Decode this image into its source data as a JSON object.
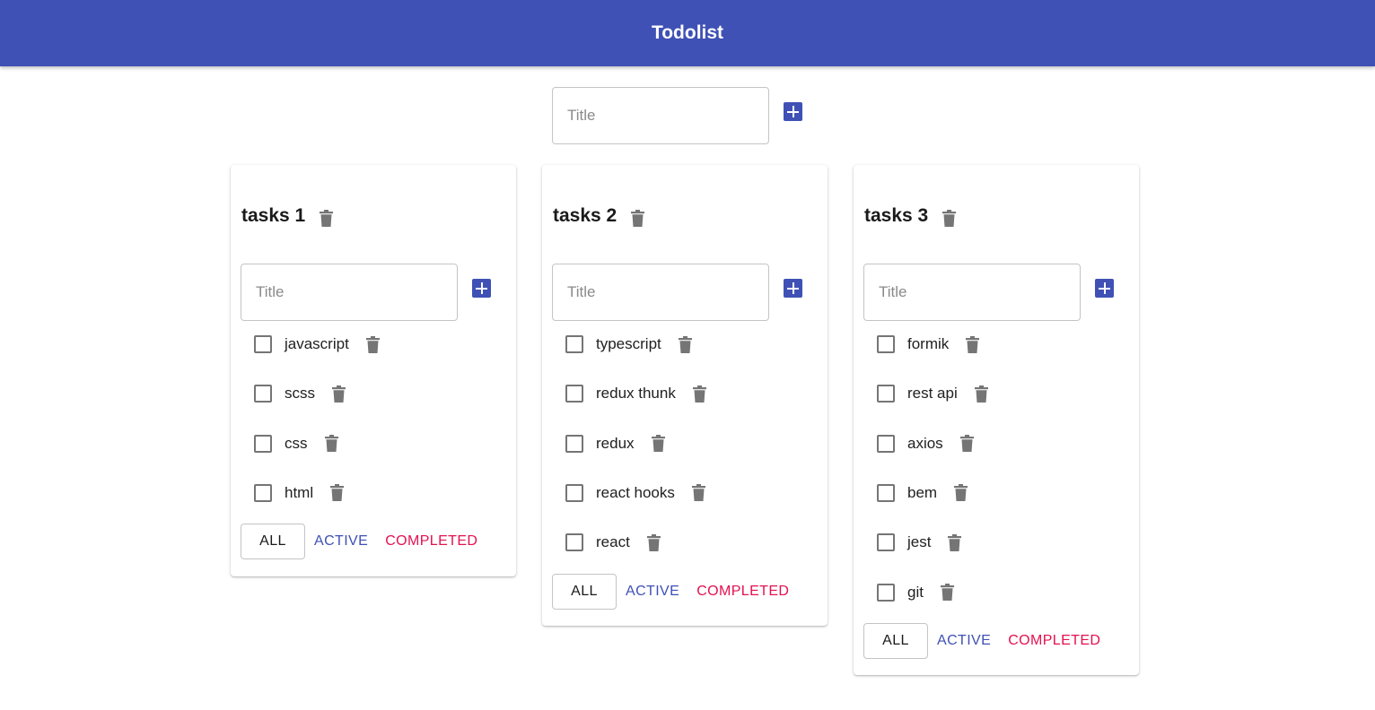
{
  "app": {
    "title": "Todolist"
  },
  "new_list": {
    "placeholder": "Title"
  },
  "lists": [
    {
      "title": "tasks 1",
      "input_placeholder": "Title",
      "tasks": [
        {
          "label": "javascript",
          "done": false
        },
        {
          "label": "scss",
          "done": false
        },
        {
          "label": "css",
          "done": false
        },
        {
          "label": "html",
          "done": false
        }
      ],
      "filters": {
        "all": "ALL",
        "active": "ACTIVE",
        "completed": "COMPLETED"
      }
    },
    {
      "title": "tasks 2",
      "input_placeholder": "Title",
      "tasks": [
        {
          "label": "typescript",
          "done": false
        },
        {
          "label": "redux thunk",
          "done": false
        },
        {
          "label": "redux",
          "done": false
        },
        {
          "label": "react hooks",
          "done": false
        },
        {
          "label": "react",
          "done": false
        }
      ],
      "filters": {
        "all": "ALL",
        "active": "ACTIVE",
        "completed": "COMPLETED"
      }
    },
    {
      "title": "tasks 3",
      "input_placeholder": "Title",
      "tasks": [
        {
          "label": "formik",
          "done": false
        },
        {
          "label": "rest api",
          "done": false
        },
        {
          "label": "axios",
          "done": false
        },
        {
          "label": "bem",
          "done": false
        },
        {
          "label": "jest",
          "done": false
        },
        {
          "label": "git",
          "done": false
        }
      ],
      "filters": {
        "all": "ALL",
        "active": "ACTIVE",
        "completed": "COMPLETED"
      }
    }
  ],
  "colors": {
    "primary": "#3f51b5",
    "secondary": "#e3114f",
    "icon": "#757575"
  },
  "icons": {
    "add": "add-box-icon",
    "delete": "trash-icon",
    "checkbox": "checkbox-outline-icon"
  }
}
